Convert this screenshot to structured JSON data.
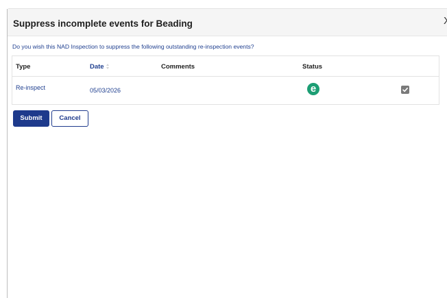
{
  "dialog": {
    "title": "Suppress incomplete events for Beading",
    "close_glyph": "X",
    "prompt": "Do you wish this NAD Inspection to suppress the following outstanding re-inspection events?"
  },
  "table": {
    "columns": [
      "Type",
      "Date",
      "Comments",
      "Status"
    ],
    "rows": [
      {
        "type": "Re-inspect",
        "date": "05/03/2026",
        "comments": "",
        "status_glyph": "e",
        "status_icon": "green-e-status-icon",
        "checked": true
      }
    ]
  },
  "actions": {
    "submit_label": "Submit",
    "cancel_label": "Cancel"
  },
  "colors": {
    "link_blue": "#1f3f8f",
    "primary_button": "#1e3a8c",
    "status_green": "#1c9e74",
    "checkbox_gray": "#7a7a7a"
  }
}
